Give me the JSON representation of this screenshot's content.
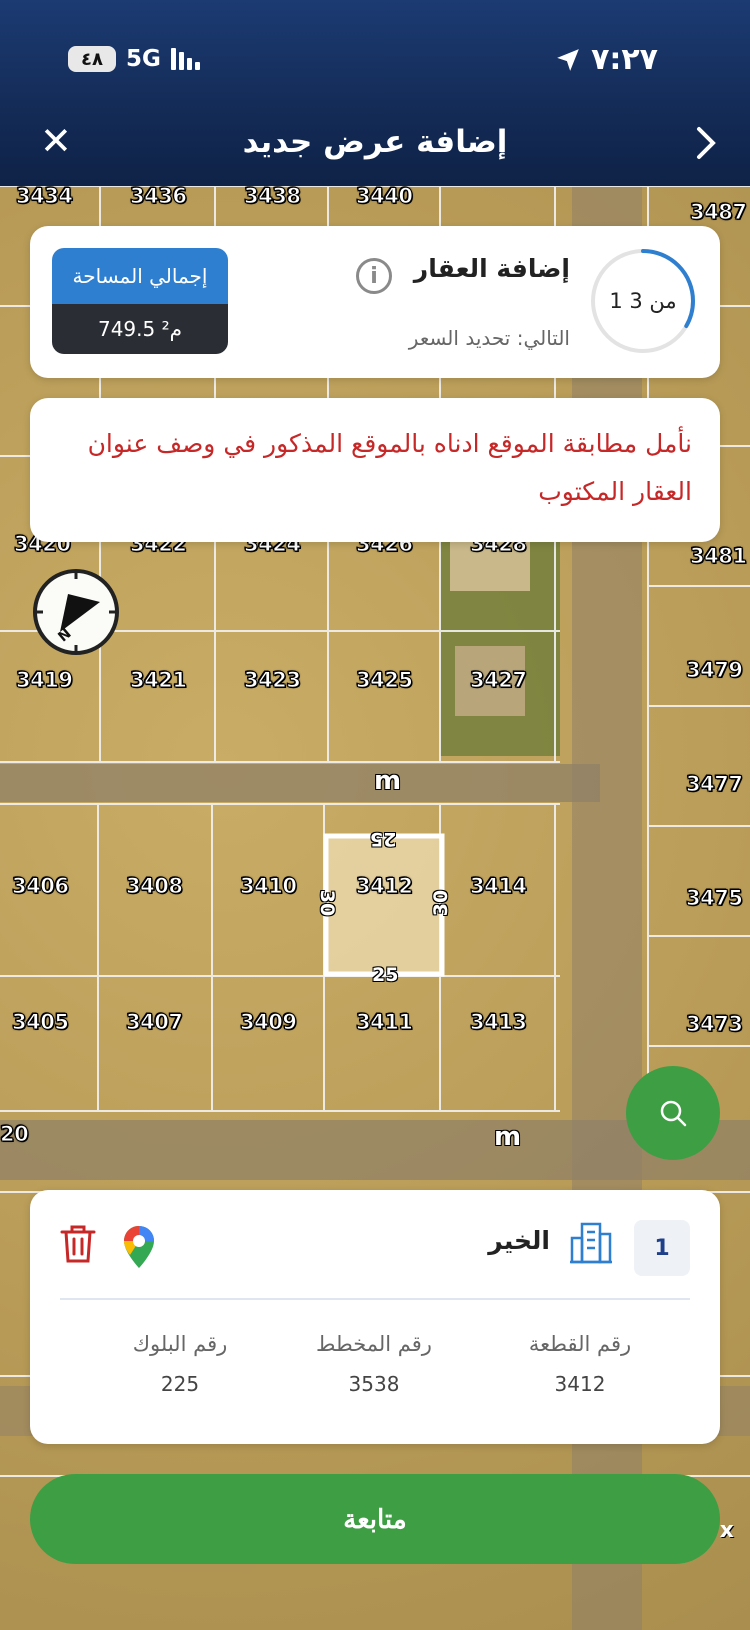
{
  "status": {
    "battery": "٤٨",
    "network": "5G",
    "time": "٧:٢٧"
  },
  "header": {
    "title": "إضافة عرض جديد",
    "close": "✕"
  },
  "step": {
    "progress_text": "1 من 3",
    "progress_fraction": 0.333,
    "title": "إضافة العقار",
    "next": "التالي: تحديد السعر",
    "info": "i"
  },
  "area": {
    "label": "إجمالي المساحة",
    "value": "749.5 م²"
  },
  "notice": {
    "text": "نأمل مطابقة الموقع ادناه بالموقع المذكور في وصف عنوان العقار المكتوب"
  },
  "map": {
    "plots": [
      "3434",
      "3436",
      "3438",
      "3440",
      "3487",
      "3420",
      "3422",
      "3424",
      "3426",
      "3428",
      "3481",
      "3419",
      "3421",
      "3423",
      "3425",
      "3427",
      "3479",
      "3477",
      "3406",
      "3408",
      "3410",
      "3412",
      "3414",
      "3475",
      "3405",
      "3407",
      "3409",
      "3411",
      "3413",
      "3473",
      "20"
    ],
    "street_label": "m",
    "dimensions": {
      "top": "25",
      "bottom": "25",
      "left": "30",
      "right": "30"
    }
  },
  "property": {
    "index": "1",
    "district": "الخير",
    "fields": [
      {
        "label": "رقم القطعة",
        "value": "3412"
      },
      {
        "label": "رقم المخطط",
        "value": "3538"
      },
      {
        "label": "رقم البلوك",
        "value": "225"
      }
    ]
  },
  "continue_label": "متابعة",
  "colors": {
    "header": "#142c58",
    "accent_green": "#3e9e44",
    "accent_blue": "#2f7fd0",
    "notice_red": "#c62828"
  },
  "icons": [
    "close-icon",
    "chevron-icon",
    "info-icon",
    "compass-icon",
    "search-icon",
    "building-icon",
    "google-maps-icon",
    "trash-icon",
    "location-arrow-icon"
  ]
}
